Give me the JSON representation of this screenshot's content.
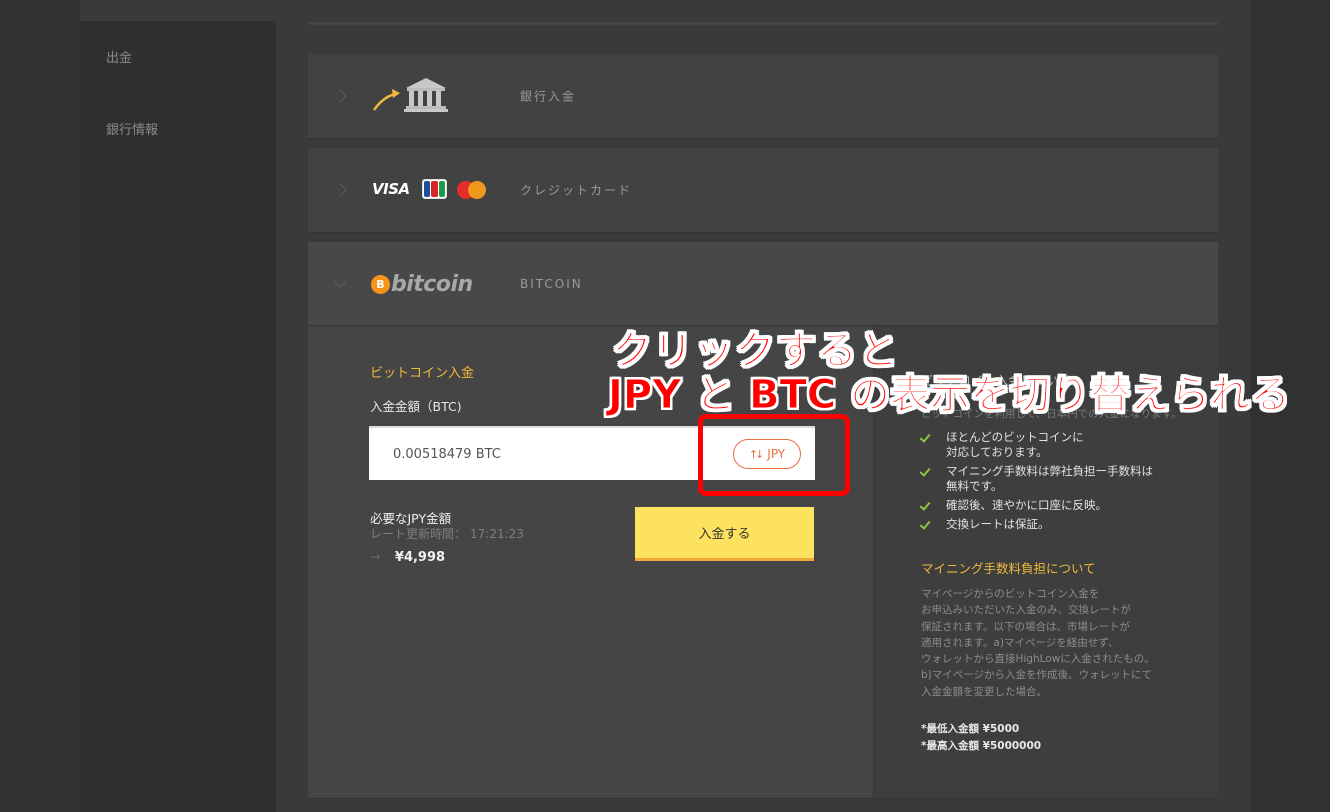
{
  "sidebar": {
    "items": [
      {
        "label": "出金"
      },
      {
        "label": "銀行情報"
      }
    ]
  },
  "methods": [
    {
      "id": "bank",
      "label": "銀行入金",
      "icon": "bank-icon",
      "expanded": false
    },
    {
      "id": "credit",
      "label": "クレジットカード",
      "icons": [
        "visa-icon",
        "jcb-icon",
        "mastercard-icon"
      ],
      "visa_text": "VISA",
      "jcb_text": "JCB",
      "expanded": false
    },
    {
      "id": "bitcoin",
      "label": "BITCOIN",
      "logo_text": "bitcoin",
      "logo_symbol": "B",
      "expanded": true
    }
  ],
  "bitcoin_form": {
    "section_title": "ビットコイン入金",
    "amount_label": "入金金額（BTC)",
    "amount_value": "0.00518479 BTC",
    "toggle_label": "JPY",
    "toggle_arrows": "⇅",
    "required_label": "必要なJPY金額",
    "rate_label": "レート更新時間：",
    "rate_time": "17:21:23",
    "arrow": "→",
    "jpy_amount": "¥4,998",
    "deposit_button": "入金する"
  },
  "info": {
    "heading": "ビットコイン入金について",
    "subtext": "ビットコインを利用して、日本円での入金になります。",
    "features": [
      {
        "line1": "ほとんどのビットコインに",
        "line2": "対応しております。"
      },
      {
        "line1": "マイニング手数料は弊社負担ー手数料は",
        "line2": "無料です。"
      },
      {
        "line1": "確認後、速やかに口座に反映。",
        "line2": ""
      },
      {
        "line1": "交換レートは保証。",
        "line2": ""
      }
    ],
    "mining_title": "マイニング手数料負担について",
    "mining_text": [
      "マイページからのビットコイン入金を",
      "お申込みいただいた入金のみ、交換レートが",
      "保証されます。以下の場合は、市場レートが",
      "適用されます。a)マイページを経由せず、",
      "ウォレットから直接HighLowに入金されたもの。",
      "b)マイページから入金を作成後、ウォレットにて",
      "入金金額を変更した場合。"
    ],
    "min_deposit": "*最低入金額 ¥5000",
    "max_deposit": "*最高入金額 ¥5000000"
  },
  "annotation": {
    "line1": "クリックすると",
    "line2": "JPY と BTC の表示を切り替えられる",
    "color": "#ff0000"
  },
  "colors": {
    "accent_gold": "#f0b93c",
    "toggle_orange": "#e86f43",
    "deposit_yellow": "#fde25f",
    "check_green": "#8cc63f",
    "bitcoin_orange": "#f7931a"
  }
}
